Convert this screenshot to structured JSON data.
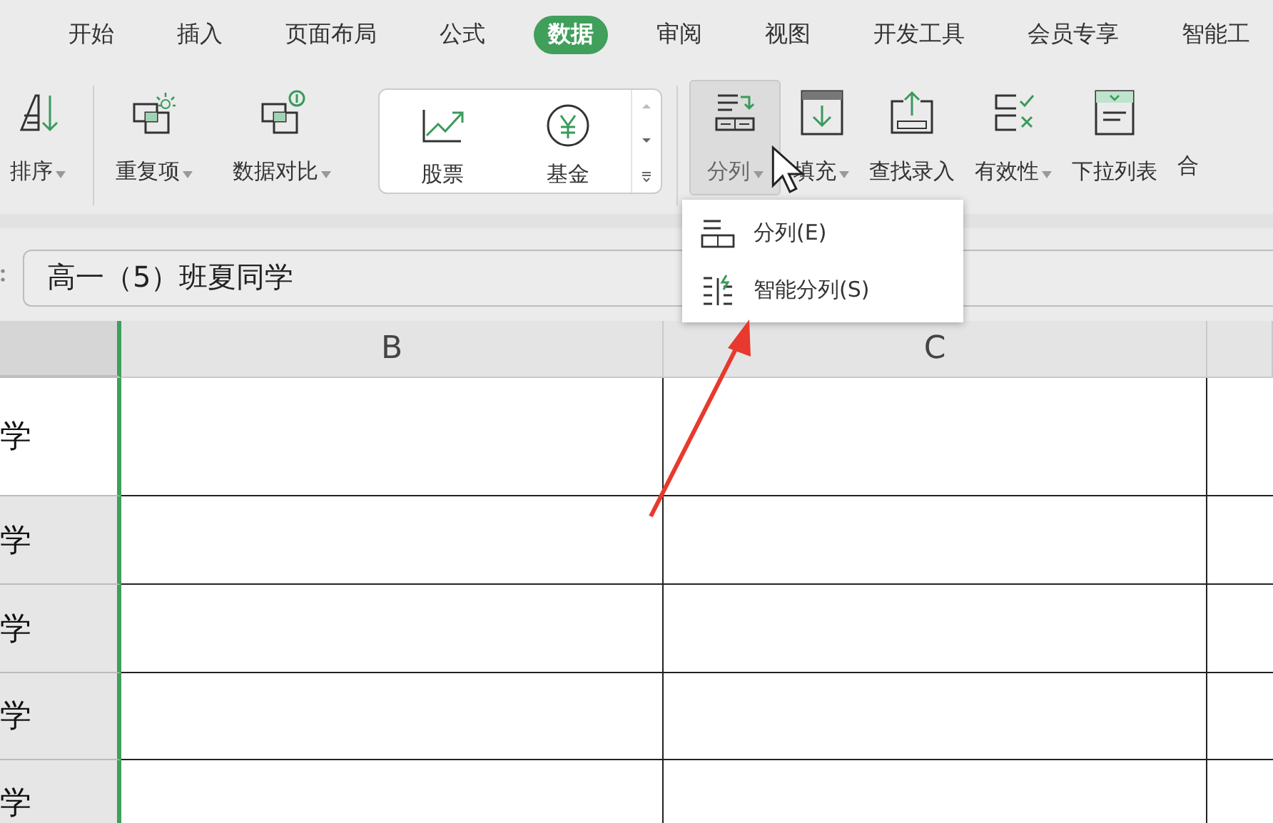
{
  "tabs": [
    {
      "label": "开始",
      "selected": false
    },
    {
      "label": "插入",
      "selected": false
    },
    {
      "label": "页面布局",
      "selected": false
    },
    {
      "label": "公式",
      "selected": false
    },
    {
      "label": "数据",
      "selected": true
    },
    {
      "label": "审阅",
      "selected": false
    },
    {
      "label": "视图",
      "selected": false
    },
    {
      "label": "开发工具",
      "selected": false
    },
    {
      "label": "会员专享",
      "selected": false
    },
    {
      "label": "智能工",
      "selected": false
    }
  ],
  "ribbon": {
    "left_items": [
      {
        "label": "排序",
        "dropdown": true,
        "hovered": false
      },
      {
        "label": "重复项",
        "dropdown": true,
        "hovered": false
      },
      {
        "label": "数据对比",
        "dropdown": true,
        "hovered": false
      }
    ],
    "gallery": [
      {
        "label": "股票"
      },
      {
        "label": "基金"
      }
    ],
    "right_items": [
      {
        "label": "分列",
        "dropdown": true,
        "hovered": true
      },
      {
        "label": "填充",
        "dropdown": true,
        "hovered": false
      },
      {
        "label": "查找录入",
        "dropdown": false,
        "hovered": false
      },
      {
        "label": "有效性",
        "dropdown": true,
        "hovered": false
      },
      {
        "label": "下拉列表",
        "dropdown": false,
        "hovered": false
      },
      {
        "label": "合",
        "dropdown": false,
        "hovered": false
      }
    ]
  },
  "dropdown_menu": {
    "items": [
      {
        "label": "分列(E)"
      },
      {
        "label": "智能分列(S)"
      }
    ]
  },
  "formula_bar": {
    "value": "高一（5）班夏同学"
  },
  "sheet": {
    "columns": [
      {
        "label": "B"
      },
      {
        "label": "C"
      }
    ],
    "rows": [
      {
        "column_a": "学",
        "active": true
      },
      {
        "column_a": "学",
        "active": false
      },
      {
        "column_a": "学",
        "active": false
      },
      {
        "column_a": "学",
        "active": false
      },
      {
        "column_a": "学",
        "active": false
      }
    ]
  }
}
